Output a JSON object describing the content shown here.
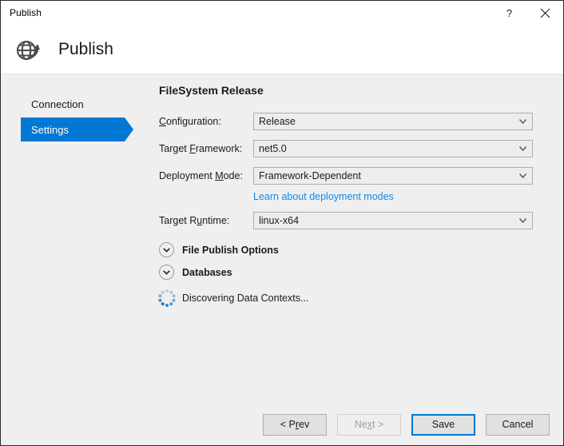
{
  "window": {
    "title": "Publish",
    "help_button": "?",
    "close_button": "close-icon"
  },
  "header": {
    "icon": "globe-publish-icon",
    "title": "Publish"
  },
  "sidebar": {
    "items": [
      {
        "label": "Connection",
        "selected": false
      },
      {
        "label": "Settings",
        "selected": true
      }
    ]
  },
  "main": {
    "section_title": "FileSystem Release",
    "fields": [
      {
        "label_pre": "",
        "label_mnemonic": "C",
        "label_post": "onfiguration:",
        "value": "Release",
        "name": "configuration"
      },
      {
        "label_pre": "Target ",
        "label_mnemonic": "F",
        "label_post": "ramework:",
        "value": "net5.0",
        "name": "target-framework"
      },
      {
        "label_pre": "Deployment ",
        "label_mnemonic": "M",
        "label_post": "ode:",
        "value": "Framework-Dependent",
        "name": "deployment-mode"
      },
      {
        "label_pre": "Target R",
        "label_mnemonic": "u",
        "label_post": "ntime:",
        "value": "linux-x64",
        "name": "target-runtime"
      }
    ],
    "deployment_link": "Learn about deployment modes",
    "expanders": [
      {
        "label": "File Publish Options",
        "name": "file-publish-options"
      },
      {
        "label": "Databases",
        "name": "databases"
      }
    ],
    "status": "Discovering Data Contexts..."
  },
  "footer": {
    "buttons": [
      {
        "label_pre": "< P",
        "label_mnemonic": "r",
        "label_post": "ev",
        "state": "normal",
        "name": "prev-button"
      },
      {
        "label_pre": "Ne",
        "label_mnemonic": "x",
        "label_post": "t >",
        "state": "disabled",
        "name": "next-button"
      },
      {
        "label_pre": "Save",
        "label_mnemonic": "",
        "label_post": "",
        "state": "default",
        "name": "save-button"
      },
      {
        "label_pre": "Cancel",
        "label_mnemonic": "",
        "label_post": "",
        "state": "normal",
        "name": "cancel-button"
      }
    ]
  },
  "colors": {
    "accent": "#0078d4",
    "link": "#0f8bea",
    "dialog_bg": "#efefef",
    "header_bg": "#ffffff"
  }
}
